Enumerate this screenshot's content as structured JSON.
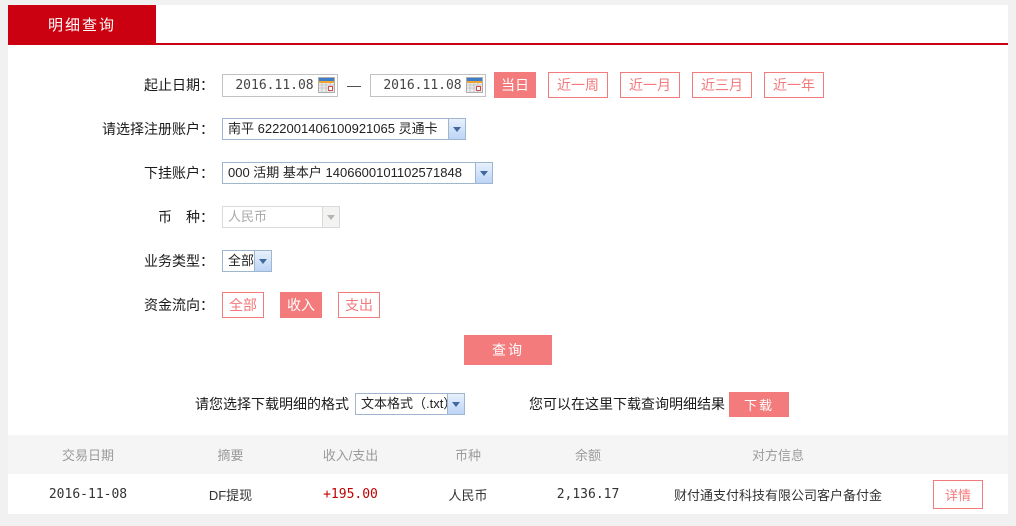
{
  "tab": {
    "label": "明细查询"
  },
  "form": {
    "date_range": {
      "label": "起止日期：",
      "start": "2016.11.08",
      "end": "2016.11.08",
      "separator": "—",
      "quick_buttons": [
        {
          "label": "当日",
          "active": true
        },
        {
          "label": "近一周",
          "active": false
        },
        {
          "label": "近一月",
          "active": false
        },
        {
          "label": "近三月",
          "active": false
        },
        {
          "label": "近一年",
          "active": false
        }
      ]
    },
    "registered_account": {
      "label": "请选择注册账户：",
      "value": "南平 6222001406100921065 灵通卡"
    },
    "sub_account": {
      "label": "下挂账户：",
      "value": "000 活期 基本户 1406600101102571848"
    },
    "currency": {
      "label": "币　种：",
      "value": "人民币",
      "disabled": true
    },
    "business_type": {
      "label": "业务类型：",
      "value": "全部"
    },
    "fund_flow": {
      "label": "资金流向：",
      "options": [
        {
          "label": "全部",
          "active": false
        },
        {
          "label": "收入",
          "active": true
        },
        {
          "label": "支出",
          "active": false
        }
      ]
    },
    "query_button": "查询"
  },
  "download": {
    "format_label": "请您选择下载明细的格式",
    "format_value": "文本格式（.txt）",
    "hint": "您可以在这里下载查询明细结果",
    "button": "下载"
  },
  "table": {
    "headers": [
      "交易日期",
      "摘要",
      "收入/支出",
      "币种",
      "余额",
      "对方信息"
    ],
    "rows": [
      {
        "date": "2016-11-08",
        "summary": "DF提现",
        "amount": "+195.00",
        "currency": "人民币",
        "balance": "2,136.17",
        "counterparty": "财付通支付科技有限公司客户备付金",
        "action": "详情"
      }
    ]
  },
  "colors": {
    "brand_red": "#cb0010",
    "pink": "#f47b7c",
    "amount_red": "#c00000",
    "table_header_bg": "#f5f5f5",
    "page_bg": "#f1f1f1"
  }
}
